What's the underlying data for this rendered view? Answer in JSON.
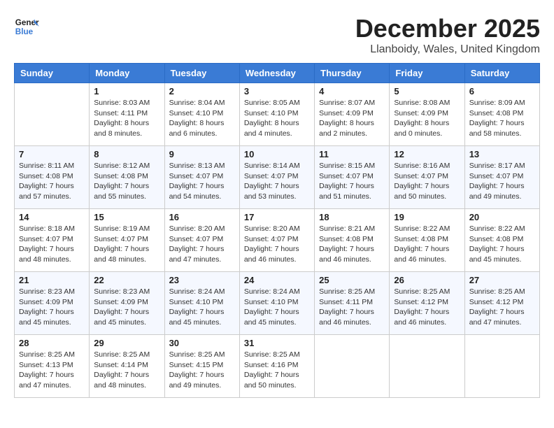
{
  "header": {
    "logo_line1": "General",
    "logo_line2": "Blue",
    "month": "December 2025",
    "location": "Llanboidy, Wales, United Kingdom"
  },
  "days": [
    "Sunday",
    "Monday",
    "Tuesday",
    "Wednesday",
    "Thursday",
    "Friday",
    "Saturday"
  ],
  "weeks": [
    [
      {
        "date": "",
        "sunrise": "",
        "sunset": "",
        "daylight": ""
      },
      {
        "date": "1",
        "sunrise": "8:03 AM",
        "sunset": "4:11 PM",
        "daylight": "8 hours and 8 minutes."
      },
      {
        "date": "2",
        "sunrise": "8:04 AM",
        "sunset": "4:10 PM",
        "daylight": "8 hours and 6 minutes."
      },
      {
        "date": "3",
        "sunrise": "8:05 AM",
        "sunset": "4:10 PM",
        "daylight": "8 hours and 4 minutes."
      },
      {
        "date": "4",
        "sunrise": "8:07 AM",
        "sunset": "4:09 PM",
        "daylight": "8 hours and 2 minutes."
      },
      {
        "date": "5",
        "sunrise": "8:08 AM",
        "sunset": "4:09 PM",
        "daylight": "8 hours and 0 minutes."
      },
      {
        "date": "6",
        "sunrise": "8:09 AM",
        "sunset": "4:08 PM",
        "daylight": "7 hours and 58 minutes."
      }
    ],
    [
      {
        "date": "7",
        "sunrise": "8:11 AM",
        "sunset": "4:08 PM",
        "daylight": "7 hours and 57 minutes."
      },
      {
        "date": "8",
        "sunrise": "8:12 AM",
        "sunset": "4:08 PM",
        "daylight": "7 hours and 55 minutes."
      },
      {
        "date": "9",
        "sunrise": "8:13 AM",
        "sunset": "4:07 PM",
        "daylight": "7 hours and 54 minutes."
      },
      {
        "date": "10",
        "sunrise": "8:14 AM",
        "sunset": "4:07 PM",
        "daylight": "7 hours and 53 minutes."
      },
      {
        "date": "11",
        "sunrise": "8:15 AM",
        "sunset": "4:07 PM",
        "daylight": "7 hours and 51 minutes."
      },
      {
        "date": "12",
        "sunrise": "8:16 AM",
        "sunset": "4:07 PM",
        "daylight": "7 hours and 50 minutes."
      },
      {
        "date": "13",
        "sunrise": "8:17 AM",
        "sunset": "4:07 PM",
        "daylight": "7 hours and 49 minutes."
      }
    ],
    [
      {
        "date": "14",
        "sunrise": "8:18 AM",
        "sunset": "4:07 PM",
        "daylight": "7 hours and 48 minutes."
      },
      {
        "date": "15",
        "sunrise": "8:19 AM",
        "sunset": "4:07 PM",
        "daylight": "7 hours and 48 minutes."
      },
      {
        "date": "16",
        "sunrise": "8:20 AM",
        "sunset": "4:07 PM",
        "daylight": "7 hours and 47 minutes."
      },
      {
        "date": "17",
        "sunrise": "8:20 AM",
        "sunset": "4:07 PM",
        "daylight": "7 hours and 46 minutes."
      },
      {
        "date": "18",
        "sunrise": "8:21 AM",
        "sunset": "4:08 PM",
        "daylight": "7 hours and 46 minutes."
      },
      {
        "date": "19",
        "sunrise": "8:22 AM",
        "sunset": "4:08 PM",
        "daylight": "7 hours and 46 minutes."
      },
      {
        "date": "20",
        "sunrise": "8:22 AM",
        "sunset": "4:08 PM",
        "daylight": "7 hours and 45 minutes."
      }
    ],
    [
      {
        "date": "21",
        "sunrise": "8:23 AM",
        "sunset": "4:09 PM",
        "daylight": "7 hours and 45 minutes."
      },
      {
        "date": "22",
        "sunrise": "8:23 AM",
        "sunset": "4:09 PM",
        "daylight": "7 hours and 45 minutes."
      },
      {
        "date": "23",
        "sunrise": "8:24 AM",
        "sunset": "4:10 PM",
        "daylight": "7 hours and 45 minutes."
      },
      {
        "date": "24",
        "sunrise": "8:24 AM",
        "sunset": "4:10 PM",
        "daylight": "7 hours and 45 minutes."
      },
      {
        "date": "25",
        "sunrise": "8:25 AM",
        "sunset": "4:11 PM",
        "daylight": "7 hours and 46 minutes."
      },
      {
        "date": "26",
        "sunrise": "8:25 AM",
        "sunset": "4:12 PM",
        "daylight": "7 hours and 46 minutes."
      },
      {
        "date": "27",
        "sunrise": "8:25 AM",
        "sunset": "4:12 PM",
        "daylight": "7 hours and 47 minutes."
      }
    ],
    [
      {
        "date": "28",
        "sunrise": "8:25 AM",
        "sunset": "4:13 PM",
        "daylight": "7 hours and 47 minutes."
      },
      {
        "date": "29",
        "sunrise": "8:25 AM",
        "sunset": "4:14 PM",
        "daylight": "7 hours and 48 minutes."
      },
      {
        "date": "30",
        "sunrise": "8:25 AM",
        "sunset": "4:15 PM",
        "daylight": "7 hours and 49 minutes."
      },
      {
        "date": "31",
        "sunrise": "8:25 AM",
        "sunset": "4:16 PM",
        "daylight": "7 hours and 50 minutes."
      },
      {
        "date": "",
        "sunrise": "",
        "sunset": "",
        "daylight": ""
      },
      {
        "date": "",
        "sunrise": "",
        "sunset": "",
        "daylight": ""
      },
      {
        "date": "",
        "sunrise": "",
        "sunset": "",
        "daylight": ""
      }
    ]
  ]
}
